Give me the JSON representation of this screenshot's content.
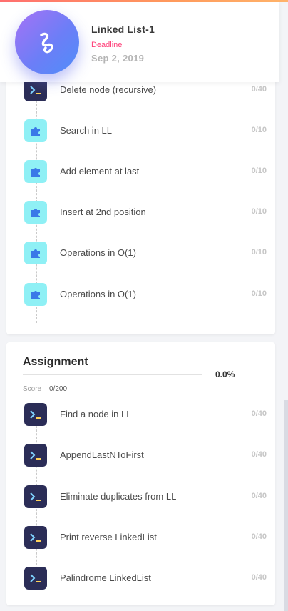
{
  "course": {
    "title": "Linked List-1",
    "deadline_label": "Deadline",
    "deadline_date": "Sep 2, 2019"
  },
  "lessons": {
    "items": [
      {
        "label": "Delete node (recursive)",
        "score": "0/40",
        "icon": "terminal-icon"
      },
      {
        "label": "Search in LL",
        "score": "0/10",
        "icon": "puzzle-icon"
      },
      {
        "label": "Add element at last",
        "score": "0/10",
        "icon": "puzzle-icon"
      },
      {
        "label": "Insert at 2nd position",
        "score": "0/10",
        "icon": "puzzle-icon"
      },
      {
        "label": "Operations in O(1)",
        "score": "0/10",
        "icon": "puzzle-icon"
      },
      {
        "label": "Operations in O(1)",
        "score": "0/10",
        "icon": "puzzle-icon"
      }
    ]
  },
  "assignment": {
    "title": "Assignment",
    "progress_percent": "0.0%",
    "progress_value": 0,
    "score_label": "Score",
    "score_value": "0/200",
    "items": [
      {
        "label": "Find a node in LL",
        "score": "0/40",
        "icon": "terminal-icon"
      },
      {
        "label": "AppendLastNToFirst",
        "score": "0/40",
        "icon": "terminal-icon"
      },
      {
        "label": "Eliminate duplicates from LL",
        "score": "0/40",
        "icon": "terminal-icon"
      },
      {
        "label": "Print reverse LinkedList",
        "score": "0/40",
        "icon": "terminal-icon"
      },
      {
        "label": "Palindrome LinkedList",
        "score": "0/40",
        "icon": "terminal-icon"
      }
    ]
  },
  "colors": {
    "accent": "#6c7ef7",
    "deadline": "#ff3d77",
    "code_icon_bg": "#2b2d57",
    "puzzle_icon_bg": "#8ff0f5"
  }
}
